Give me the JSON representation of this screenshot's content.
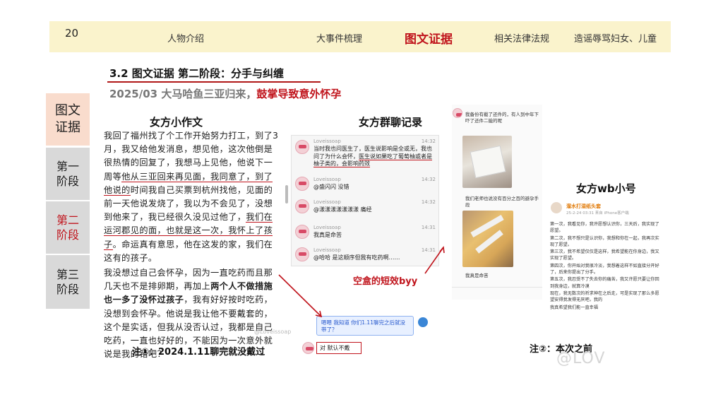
{
  "page_number": "20",
  "nav": {
    "items": [
      "人物介绍",
      "大事件梳理",
      "图文证据",
      "相关法律法规",
      "造谣辱骂妇女、儿童"
    ],
    "active_index": 2
  },
  "section": {
    "title": "3.2 图文证据   第二阶段：分手与纠缠",
    "subtitle_plain": "2025/03   大马哈鱼三亚归来，",
    "subtitle_highlight": "鼓掌导致意外怀孕"
  },
  "sidebar": {
    "items": [
      "图文\n证据",
      "第一\n阶段",
      "第二\n阶段",
      "第三\n阶段"
    ],
    "active_index": 2
  },
  "essay": {
    "title": "女方小作文",
    "p1_a": "我回了福州找了个工作开始努力打工，到了3月，我又给他发消息，想见他，这次他倒是很热情的回复了，我想马上见他，他说下一周等",
    "p1_b": "他从三亚回来再见面，我同意了，到了他说的",
    "p1_c": "时间我自己买票到杭州找他，见面的前一天他说发烧了，我以为不会见了，没想到他来了，我已经很久没见过他了，",
    "p1_d": "我们在运河郡见的",
    "p1_e": "面，也就是这一次，我怀上了孩子",
    "p1_f": "。命运真有意思，他在这发的家，我们在这有的孩子。",
    "p2_a": "我没想过自己会怀孕，因为一直吃药而且那几天也不是排卵期，再加上",
    "p2_b": "两个人不做措施也一多了没怀过孩子",
    "p2_c": "，我有好好按时吃药，没想到会怀孕。他说是我让他不要戴套的，这个是实话，但我从没否认过，我都是自己吃药，一直也好好的，不能因为一次意外就说是我的错吧？",
    "watermark": "@Loveissoap",
    "note": "注①：2024.1.11聊完就没戴过"
  },
  "chat": {
    "title": "女方群聊记录",
    "messages": [
      {
        "name": "Loveissoap",
        "time": "14:32",
        "text_a": "当时我也问医生了，医生说影响是全或无，我也问了为什么会怀，",
        "text_b": "医生说如果吃了葡萄柚或者是柚子类的，会影响药效"
      },
      {
        "name": "Loveissoap",
        "time": "14:32",
        "text_a": "@盛闪闪 没错",
        "text_b": ""
      },
      {
        "name": "Loveissoap",
        "time": "14:32",
        "text_a": "@漾漾漾漾漾漾漾 痛经",
        "text_b": ""
      },
      {
        "name": "Loveissoap",
        "time": "14:31",
        "text_a": "我真是命苦",
        "text_b": ""
      },
      {
        "name": "Loveissoap",
        "time": "14:31",
        "text_a": "@哈哈 是这顺序但我有吃药啊……",
        "text_b": ""
      }
    ],
    "blue_bubble": "嗯嗯 我知道 你们1.11聊完之后就没带了？",
    "reply": "对 默认不戴",
    "annotation": "空盒的短效byy"
  },
  "photos": {
    "msg1": "我备份有截了还件的，有人到中年下吓了还件二能的呢",
    "msg2": "我们老师也说没有百分之百的避孕手段",
    "msg3": "我真是命苦"
  },
  "weibo": {
    "title": "女方wb小号",
    "user": "溜水打湿纸头套",
    "meta": "25-2-24 03:31 来自 iPhone客户端",
    "lines": [
      "第一次，我看见你，我许愿想认识你，三天后，我实现了愿望。",
      "第二次，我不想只是认识你，我想和你在一起，我再次实现了愿望。",
      "第三次，我不希望仅仅是这样，我希望能在你身边，我又实现了愿望。",
      "第四次，你开始对我很冷淡，我想着这样不如直接分开好了，后来你提出了分手。",
      "第五次，我忍受不了失去你的痛苦，我又许愿只要让你回到我身边，就算冷漠",
      "现在，我无数次的祈求神在之后走，可是实现了那么多愿望安得我发得无厌吧，我的",
      "我真希望我们能一直幸福"
    ],
    "note": "注②：本次之前",
    "watermark": "@LOV"
  },
  "colors": {
    "accent_red": "#c0141c",
    "nav_bg": "#faf3cc",
    "sidebar_active": "#f9dccd",
    "sidebar_inactive": "#d9d9d9"
  }
}
